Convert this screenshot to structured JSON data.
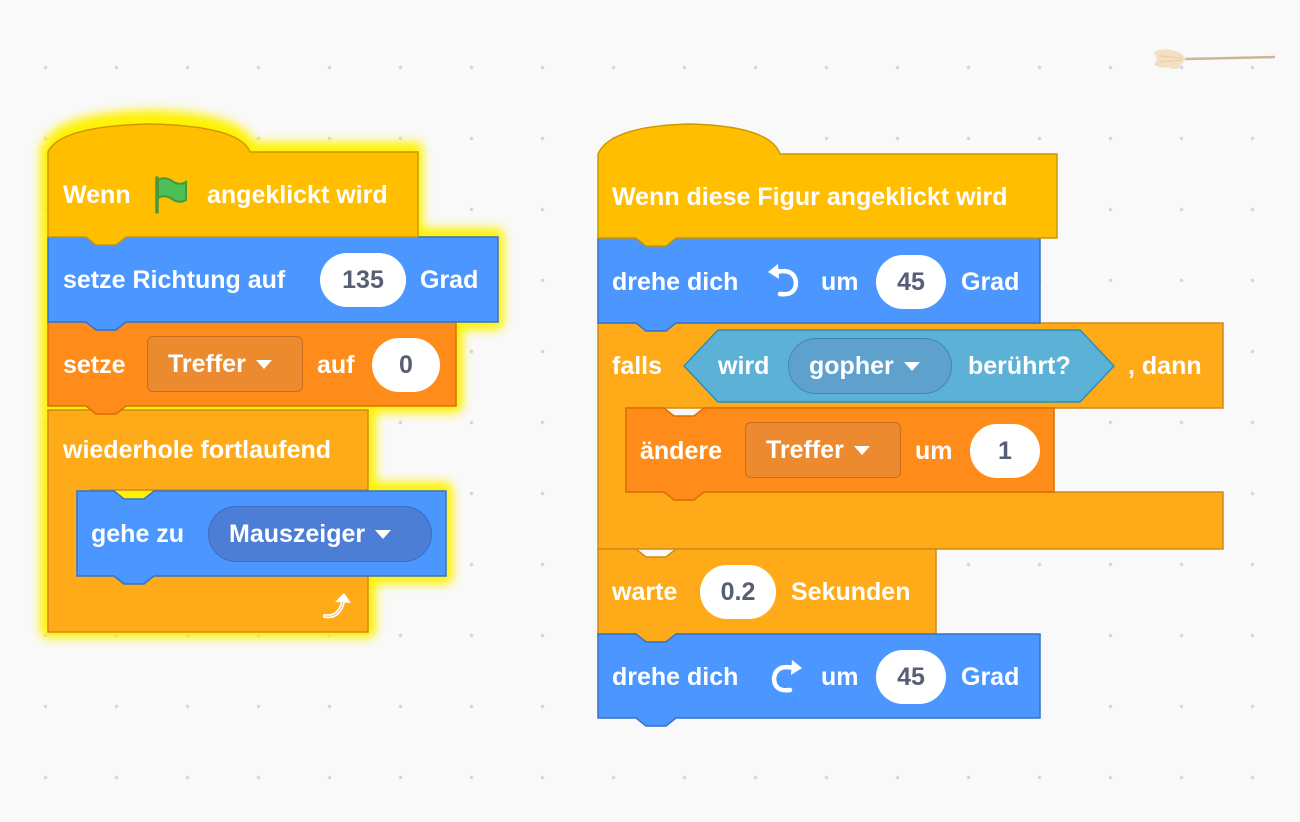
{
  "broom": {
    "icon": "broom-icon"
  },
  "script1": {
    "hat": {
      "prefix": "Wenn",
      "flag_icon": "green-flag-icon",
      "suffix": "angeklickt wird"
    },
    "set_direction": {
      "label": "setze Richtung auf",
      "value": "135",
      "unit": "Grad"
    },
    "set_var": {
      "label": "setze",
      "variable": "Treffer",
      "to": "auf",
      "value": "0"
    },
    "forever": {
      "label": "wiederhole fortlaufend",
      "loop_icon": "loop-arrow-icon"
    },
    "goto": {
      "label": "gehe zu",
      "target": "Mauszeiger"
    }
  },
  "script2": {
    "hat": {
      "label": "Wenn diese Figur angeklickt wird"
    },
    "turn_left": {
      "label": "drehe dich",
      "icon": "rotate-left-icon",
      "by": "um",
      "value": "45",
      "unit": "Grad"
    },
    "if": {
      "label": "falls",
      "then": ", dann",
      "touching": {
        "label": "wird",
        "target": "gopher",
        "suffix": "berührt?"
      }
    },
    "change_var": {
      "label": "ändere",
      "variable": "Treffer",
      "by": "um",
      "value": "1"
    },
    "wait": {
      "label": "warte",
      "value": "0.2",
      "unit": "Sekunden"
    },
    "turn_right": {
      "label": "drehe dich",
      "icon": "rotate-right-icon",
      "by": "um",
      "value": "45",
      "unit": "Grad"
    }
  },
  "colors": {
    "events": "#ffbf00",
    "motion": "#4c97ff",
    "variables": "#ff8c1a",
    "control": "#ffab19",
    "sensing": "#5cb1d6",
    "glow": "#fff200"
  }
}
